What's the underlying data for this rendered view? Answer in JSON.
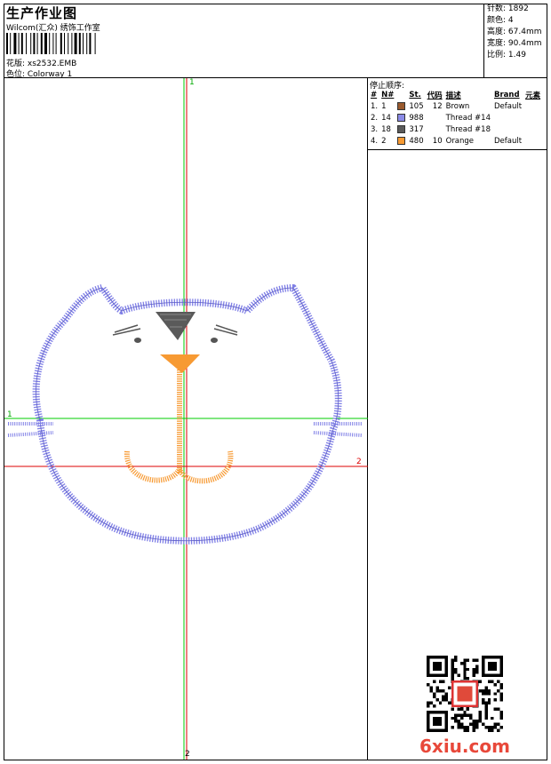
{
  "header": {
    "title": "生产作业图",
    "subtitle": "Wilcom(汇众) 绣饰工作室",
    "design_file": "花版: xs2532.EMB",
    "colorway": "色位: Colorway 1"
  },
  "stats": [
    {
      "label": "针数",
      "value": "1892"
    },
    {
      "label": "颜色",
      "value": "4"
    },
    {
      "label": "高度",
      "value": "67.4mm"
    },
    {
      "label": "宽度",
      "value": "90.4mm"
    },
    {
      "label": "比例",
      "value": "1.49"
    }
  ],
  "stop_sequence": {
    "title": "停止顺序:",
    "headers": [
      "#",
      "N#",
      "St.",
      "代码",
      "描述",
      "Brand",
      "元素"
    ],
    "rows": [
      {
        "idx": "1.",
        "n": "1",
        "color": "#9a5a2e",
        "st": "105",
        "code": "12",
        "desc": "Brown",
        "brand": "Default"
      },
      {
        "idx": "2.",
        "n": "14",
        "color": "#8a8ae6",
        "st": "988",
        "code": "",
        "desc": "Thread #14",
        "brand": ""
      },
      {
        "idx": "3.",
        "n": "18",
        "color": "#5a5a5a",
        "st": "317",
        "code": "",
        "desc": "Thread #18",
        "brand": ""
      },
      {
        "idx": "4.",
        "n": "2",
        "color": "#f79a33",
        "st": "480",
        "code": "10",
        "desc": "Orange",
        "brand": "Default"
      }
    ]
  },
  "axes": {
    "v1_label": "1",
    "h1_label": "1",
    "v2_label": "2",
    "h2_label": "2"
  },
  "colors": {
    "outline": "#7f7fe6",
    "mouth": "#f79a33",
    "dark": "#555555",
    "green_axis": "#00cc00",
    "red_axis": "#dd0000"
  },
  "watermark": {
    "site": "6xiu.com"
  }
}
